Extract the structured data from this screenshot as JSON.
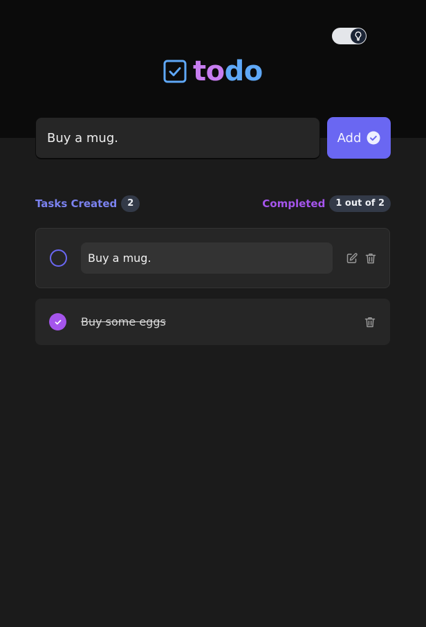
{
  "theme_toggle": {
    "icon": "lightbulb-icon"
  },
  "logo": {
    "icon": "checkbox-icon",
    "part_to": "to",
    "part_do": "do"
  },
  "new_task": {
    "value": "Buy a mug."
  },
  "add_button": {
    "label": "Add",
    "icon": "check-circle-icon"
  },
  "counters": {
    "created_label": "Tasks Created",
    "created_count": "2",
    "completed_label": "Completed",
    "completed_count": "1 out of 2"
  },
  "tasks": [
    {
      "text": "Buy a mug.",
      "completed": false,
      "editing": true
    },
    {
      "text": "Buy some eggs",
      "completed": true,
      "editing": false
    }
  ],
  "colors": {
    "accent": "#6a67f2",
    "done": "#a555ec",
    "logo_to": "#c77df0",
    "logo_do": "#5fa8f7"
  }
}
